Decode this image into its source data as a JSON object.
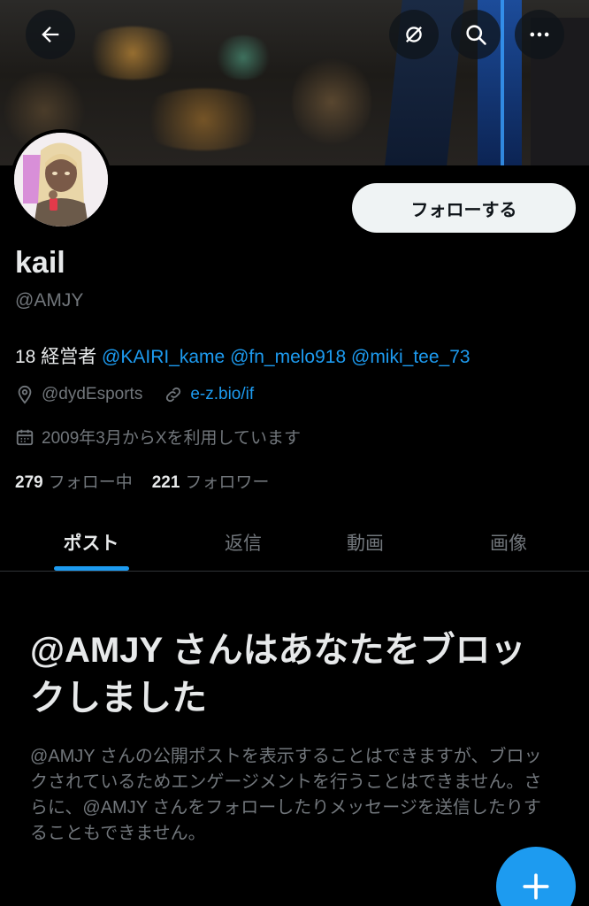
{
  "header": {
    "back_icon": "arrow-left-icon",
    "grok_icon": "grok-icon",
    "search_icon": "search-icon",
    "more_icon": "more-horizontal-icon"
  },
  "profile": {
    "name": "kail",
    "handle": "@AMJY",
    "follow_label": "フォローする",
    "bio_prefix": "18 経営者 ",
    "bio_mentions": [
      "@KAIRI_kame",
      "@fn_melo918",
      "@miki_tee_73"
    ],
    "location": "@dydEsports",
    "website": "e-z.bio/if",
    "joined": "2009年3月からXを利用しています",
    "following_count": "279",
    "following_label": "フォロー中",
    "followers_count": "221",
    "followers_label": "フォロワー"
  },
  "tabs": [
    {
      "label": "ポスト",
      "active": true
    },
    {
      "label": "返信",
      "active": false
    },
    {
      "label": "動画",
      "active": false
    },
    {
      "label": "画像",
      "active": false
    }
  ],
  "blocked": {
    "title": "@AMJY さんはあなたをブロックしました",
    "body": "@AMJY さんの公開ポストを表示することはできますが、ブロックされているためエンゲージメントを行うことはできません。さらに、@AMJY さんをフォローしたりメッセージを送信したりすることもできません。"
  },
  "fab": {
    "icon": "plus-icon"
  },
  "colors": {
    "accent": "#1d9bf0",
    "background": "#000000",
    "muted": "#71767b",
    "text": "#e7e9ea"
  }
}
